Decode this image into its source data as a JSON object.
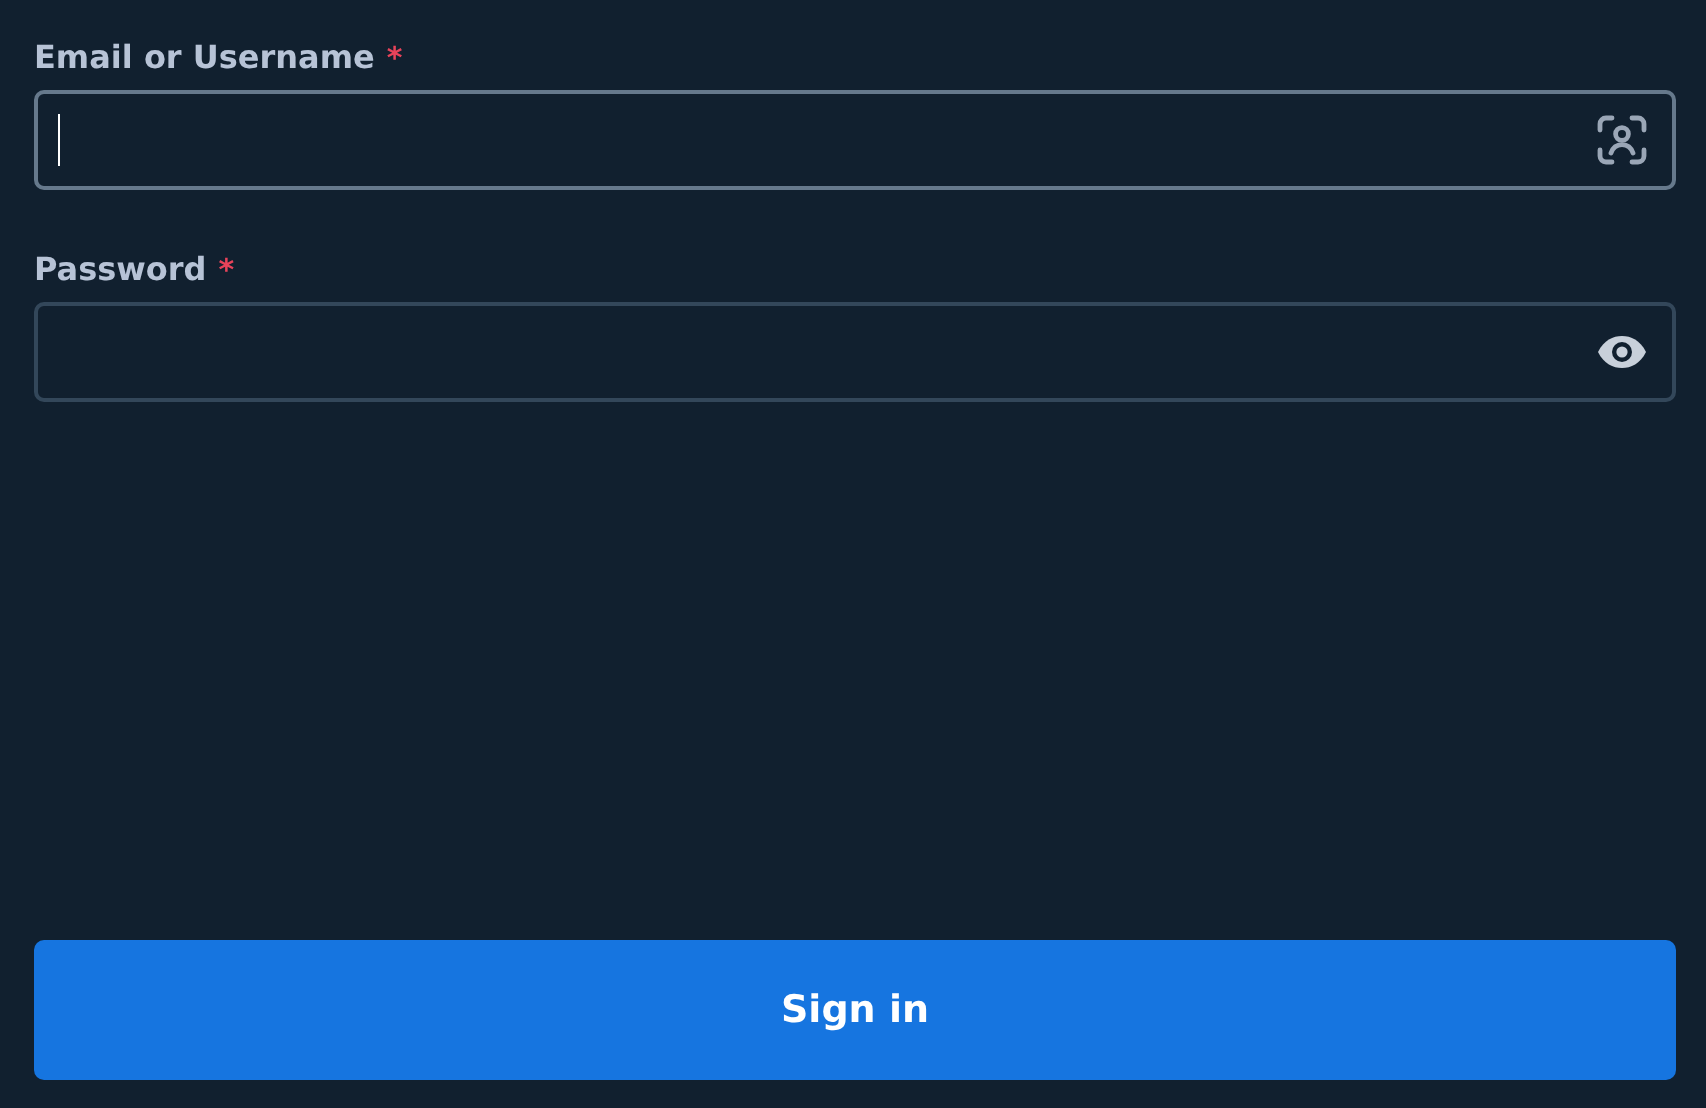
{
  "fields": [
    {
      "label": "Email or Username",
      "required_mark": "*",
      "kind": "person",
      "focused": true
    },
    {
      "label": "Password",
      "required_mark": "*",
      "kind": "eye",
      "focused": false
    }
  ],
  "button": {
    "label": "Sign in"
  }
}
